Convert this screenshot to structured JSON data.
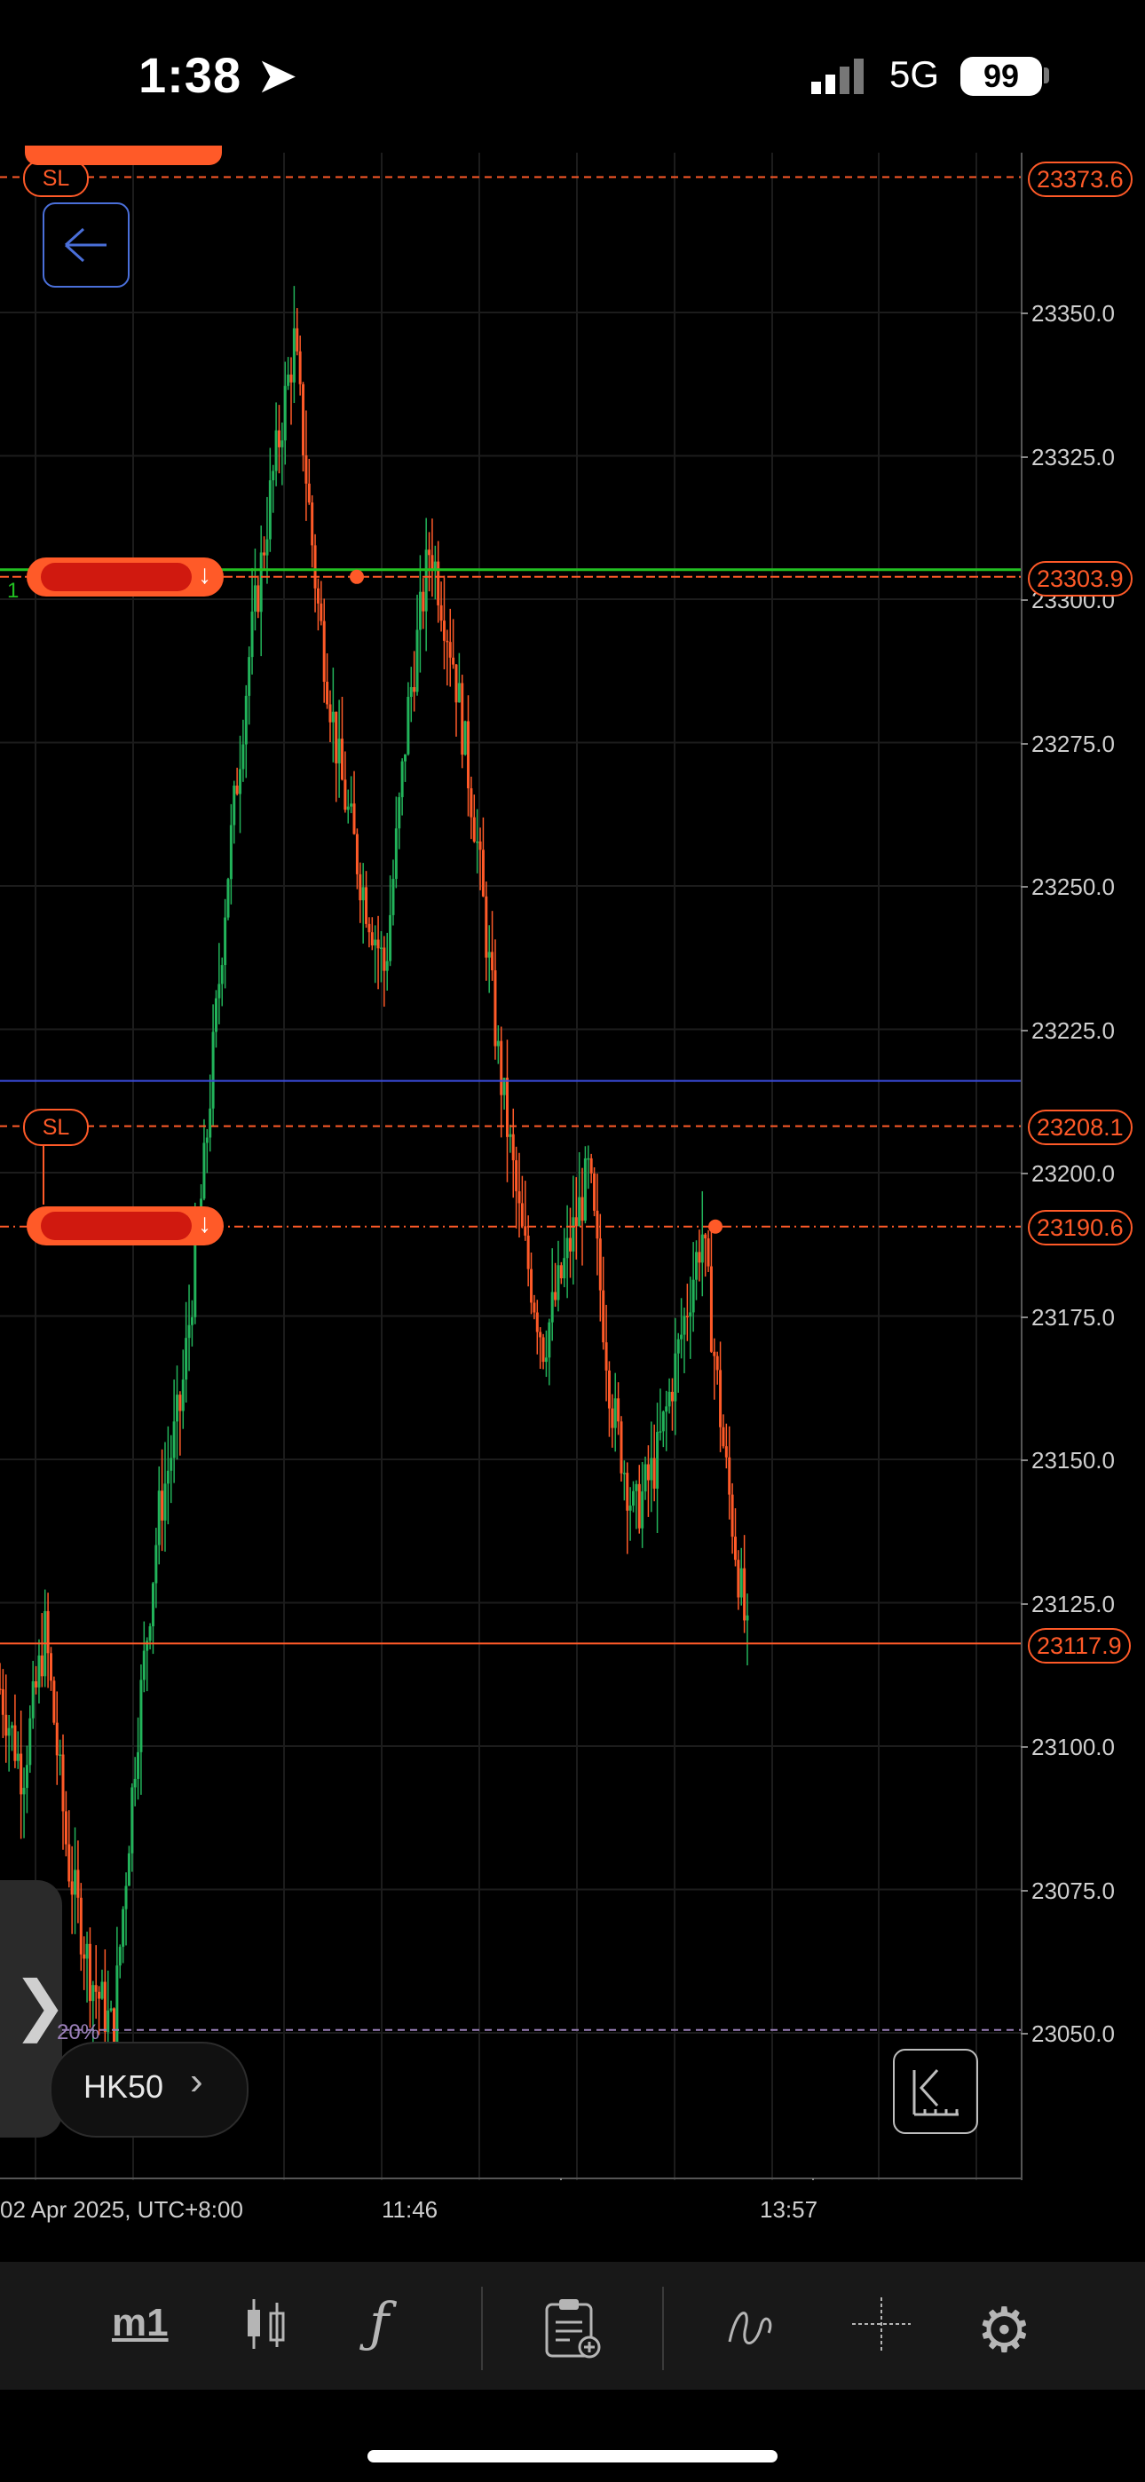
{
  "status_bar": {
    "time": "1:38",
    "network": "5G",
    "battery": "99"
  },
  "chart": {
    "symbol": "HK50",
    "timeframe": "m1",
    "y_axis_ticks": [
      "23350.0",
      "23325.0",
      "23300.0",
      "23275.0",
      "23250.0",
      "23225.0",
      "23200.0",
      "23175.0",
      "23150.0",
      "23125.0",
      "23100.0",
      "23075.0",
      "23050.0"
    ],
    "price_tags": {
      "sl_top": "23373.6",
      "entry_top": "23303.9",
      "sl_mid": "23208.1",
      "entry_mid": "23190.6",
      "current": "23117.9"
    },
    "sl_label": "SL",
    "x_axis_labels": {
      "left": "02 Apr 2025, UTC+8:00",
      "mid": "11:46",
      "right": "13:57"
    },
    "pct_label": "20%",
    "line_colors": {
      "bid": "#ff5a28",
      "entry": "#22c022",
      "blue": "#3a4bdc"
    }
  },
  "chart_data": {
    "type": "candlestick",
    "symbol": "HK50",
    "timeframe": "m1",
    "ylim": [
      23030,
      23380
    ],
    "x": [
      "02 Apr 2025, UTC+8:00",
      "11:46",
      "13:57"
    ],
    "price_levels": [
      23373.6,
      23303.9,
      23208.1,
      23190.6,
      23117.9
    ],
    "close_path": [
      23110,
      23095,
      23120,
      23080,
      23060,
      23050,
      23100,
      23140,
      23160,
      23200,
      23250,
      23290,
      23320,
      23345,
      23300,
      23270,
      23250,
      23235,
      23280,
      23310,
      23290,
      23260,
      23220,
      23190,
      23170,
      23185,
      23200,
      23160,
      23140,
      23150,
      23170,
      23190,
      23150,
      23117.9
    ]
  },
  "toolbar": {
    "timeframe_label": "m1",
    "icons": [
      "candlestick-icon",
      "function-icon",
      "order-clipboard-icon",
      "draw-icon",
      "crosshair-icon",
      "settings-gear-icon"
    ]
  }
}
